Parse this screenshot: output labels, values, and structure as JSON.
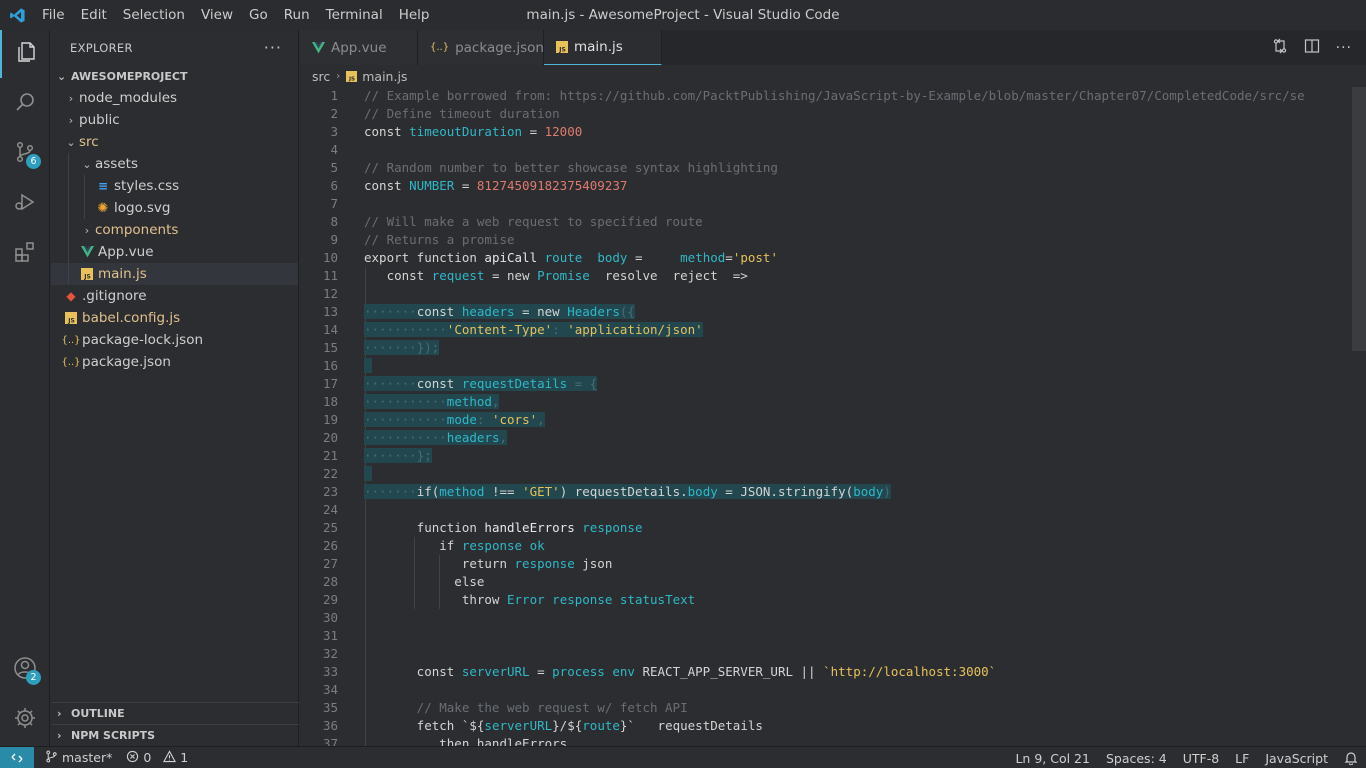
{
  "titlebar": {
    "menu": [
      "File",
      "Edit",
      "Selection",
      "View",
      "Go",
      "Run",
      "Terminal",
      "Help"
    ],
    "window_title": "main.js - AwesomeProject - Visual Studio Code"
  },
  "activity": {
    "scm_badge": "6",
    "accounts_badge": "2"
  },
  "sidebar": {
    "title": "EXPLORER",
    "more": "···",
    "project": "AWESOMEPROJECT",
    "tree": [
      {
        "label": "node_modules"
      },
      {
        "label": "public"
      },
      {
        "label": "src"
      },
      {
        "label": "assets"
      },
      {
        "label": "styles.css"
      },
      {
        "label": "logo.svg"
      },
      {
        "label": "components"
      },
      {
        "label": "App.vue"
      },
      {
        "label": "main.js"
      },
      {
        "label": ".gitignore"
      },
      {
        "label": "babel.config.js"
      },
      {
        "label": "package-lock.json"
      },
      {
        "label": "package.json"
      }
    ],
    "outline": "OUTLINE",
    "npm_scripts": "NPM SCRIPTS"
  },
  "tabs": [
    {
      "label": "App.vue"
    },
    {
      "label": "package.json"
    },
    {
      "label": "main.js"
    }
  ],
  "breadcrumb": {
    "folder": "src",
    "file": "main.js"
  },
  "editor": {
    "line_numbers": [
      "1",
      "2",
      "3",
      "4",
      "5",
      "6",
      "7",
      "8",
      "9",
      "10",
      "11",
      "12",
      "13",
      "14",
      "15",
      "16",
      "17",
      "18",
      "19",
      "20",
      "21",
      "22",
      "23",
      "24",
      "25",
      "26",
      "27",
      "28",
      "29",
      "30",
      "31",
      "32",
      "33",
      "34",
      "35",
      "36",
      "37"
    ],
    "lines": {
      "l1": "// Example borrowed from: https://github.com/PacktPublishing/JavaScript-by-Example/blob/master/Chapter07/CompletedCode/src/se",
      "l2": "// Define timeout duration",
      "l3_kw": "const ",
      "l3_id": "timeoutDuration",
      "l3_op": " = ",
      "l3_num": "12000",
      "l5": "// Random number to better showcase syntax highlighting",
      "l6_kw": "const ",
      "l6_id": "NUMBER",
      "l6_op": " = ",
      "l6_num": "81274509182375409237",
      "l8": "// Will make a web request to specified route",
      "l9": "// Returns a promise",
      "l10_a": "export function ",
      "l10_fn": "apiCall",
      "l10_b": " ",
      "l10_id1": "route",
      "l10_c": "  ",
      "l10_id2": "body",
      "l10_d": " =     ",
      "l10_id3": "method",
      "l10_e": "=",
      "l10_str": "'post'",
      "l11_a": "   const ",
      "l11_id": "request",
      "l11_b": " = new ",
      "l11_id2": "Promise",
      "l11_c": "  resolve  reject  =>",
      "l13_dots": "·······",
      "l13_a": "const ",
      "l13_id": "headers",
      "l13_b": " = new ",
      "l13_id2": "Headers",
      "l13_c": "({",
      "l14_dots": "···········",
      "l14_str1": "'Content-Type'",
      "l14_a": ": ",
      "l14_str2": "'application/json'",
      "l15_dots": "·······",
      "l15_a": "});",
      "l17_dots": "·······",
      "l17_a": "const ",
      "l17_id": "requestDetails",
      "l17_b": " = {",
      "l18_dots": "···········",
      "l18_id": "method",
      "l18_a": ",",
      "l19_dots": "···········",
      "l19_id": "mode",
      "l19_a": ": ",
      "l19_str": "'cors'",
      "l19_b": ",",
      "l20_dots": "···········",
      "l20_id": "headers",
      "l20_a": ",",
      "l21_dots": "·······",
      "l21_a": "};",
      "l23_dots": "·······",
      "l23_a": "if(",
      "l23_id": "method",
      "l23_b": " !== ",
      "l23_str": "'GET'",
      "l23_c": ") requestDetails.",
      "l23_id2": "body",
      "l23_d": " = JSON.stringify(",
      "l23_id3": "body",
      "l23_e": ")",
      "l25_a": "       function ",
      "l25_fn": "handleErrors",
      "l25_b": " ",
      "l25_id": "response",
      "l26_a": "          if ",
      "l26_id": "response",
      "l26_b": " ",
      "l26_id2": "ok",
      "l27_a": "             return ",
      "l27_id": "response",
      "l27_b": " json",
      "l28_a": "            else",
      "l29_a": "             throw ",
      "l29_id": "Error",
      "l29_b": " ",
      "l29_id2": "response",
      "l29_c": " ",
      "l29_id3": "statusText",
      "l33_a": "       const ",
      "l33_id": "serverURL",
      "l33_b": " = ",
      "l33_id2": "process",
      "l33_c": " ",
      "l33_id3": "env",
      "l33_d": " REACT_APP_SERVER_URL || ",
      "l33_str": "`http://localhost:3000`",
      "l35": "       // Make the web request w/ fetch API",
      "l36_a": "       fetch ",
      "l36_b": "`${",
      "l36_id": "serverURL",
      "l36_c": "}/${",
      "l36_id2": "route",
      "l36_d": "}`  ",
      "l36_e": " requestDetails",
      "l37_a": "          then handleErrors"
    }
  },
  "statusbar": {
    "branch": "master*",
    "errors": "0",
    "warnings": "1",
    "position": "Ln 9, Col 21",
    "spaces": "Spaces: 4",
    "encoding": "UTF-8",
    "eol": "LF",
    "language": "JavaScript"
  },
  "colors": {
    "accent": "#52b5d8",
    "selection": "#22474f",
    "identifier": "#2fb8c8",
    "string": "#e8c15a",
    "number": "#e07a6e"
  }
}
